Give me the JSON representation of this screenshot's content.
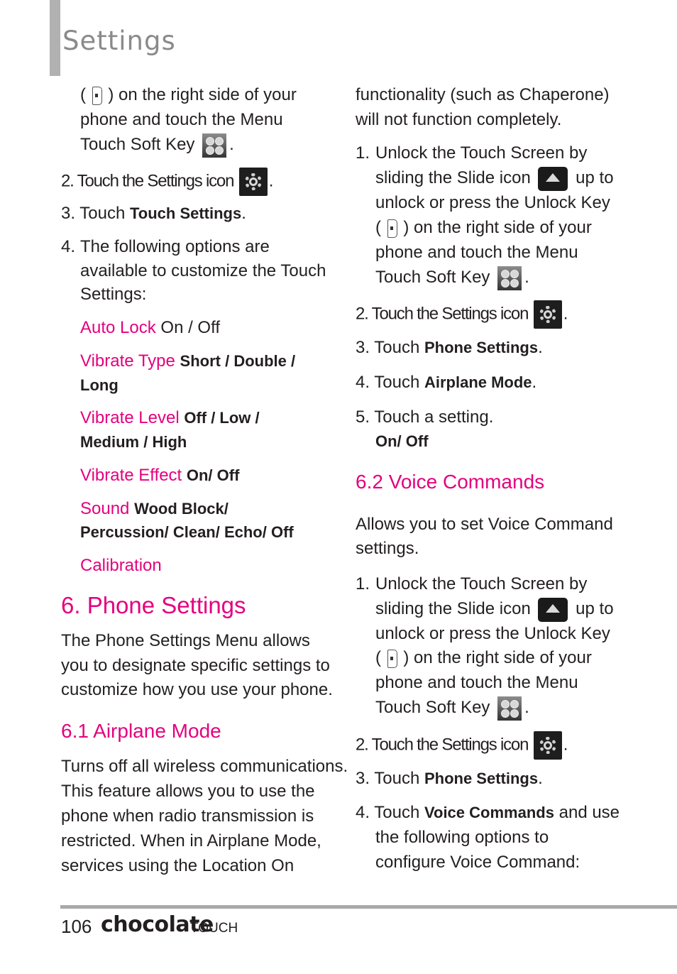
{
  "header": {
    "title": "Settings"
  },
  "left": {
    "intro_line1_after_icon": ") on the right side of your",
    "intro_line1_before_icon": "(",
    "intro_line2": "phone and touch the Menu",
    "intro_line3": "Touch Soft Key",
    "intro_line3_end": ".",
    "step2_num": "2.",
    "step2_text": "Touch the Settings icon",
    "step2_end": ".",
    "step3_num": "3.",
    "step3_text": "Touch",
    "step3_bold": "Touch Settings",
    "step3_end": ".",
    "step4_num": "4.",
    "step4_lines": [
      "The following options are",
      "available to customize the Touch",
      "Settings:"
    ],
    "options": [
      {
        "label": "Auto Lock",
        "values": "On / Off"
      },
      {
        "label": "Vibrate Type",
        "values": "Short / Double /",
        "values2": "Long"
      },
      {
        "label": "Vibrate Level",
        "values": "Off / Low /",
        "values2": "Medium / High"
      },
      {
        "label": "Vibrate Effect",
        "values": "On/ Off"
      },
      {
        "label": "Sound",
        "values": "Wood Block/",
        "values2": "Percussion/ Clean/ Echo/ Off"
      },
      {
        "label": "Calibration"
      }
    ],
    "section_title": "6. Phone Settings",
    "section_body": [
      "The Phone Settings Menu allows",
      "you to designate specific settings to",
      "customize how you use your phone."
    ],
    "sub1_title": "6.1 Airplane Mode",
    "sub1_body": [
      "Turns off all wireless communications.",
      "This feature allows you to use the",
      "phone when radio transmission is",
      "restricted. When in Airplane Mode,",
      "services using the Location On"
    ]
  },
  "right": {
    "cont_lines": [
      "functionality (such as Chaperone)",
      "will not function completely."
    ],
    "a_step1_num": "1.",
    "a_step1_l1": "Unlock the Touch Screen by",
    "a_step1_l2a": "sliding the Slide icon",
    "a_step1_l2b": "up to",
    "a_step1_l3": "unlock or press the Unlock Key",
    "a_step1_l4a": "(",
    "a_step1_l4b": ") on the right side of your",
    "a_step1_l5": "phone and touch the Menu",
    "a_step1_l6": "Touch Soft Key",
    "a_step1_l6_end": ".",
    "a_step2_num": "2.",
    "a_step2_text": "Touch the Settings icon",
    "a_step2_end": ".",
    "a_step3_num": "3.",
    "a_step3_text": "Touch",
    "a_step3_bold": "Phone Settings",
    "a_step3_end": ".",
    "a_step4_num": "4.",
    "a_step4_text": "Touch",
    "a_step4_bold": "Airplane Mode",
    "a_step4_end": ".",
    "a_step5_num": "5.",
    "a_step5_text": "Touch a setting.",
    "a_step5_bold": "On/ Off",
    "sub2_title": "6.2 Voice Commands",
    "sub2_body": [
      "Allows you to set Voice Command",
      "settings."
    ],
    "v_step1_num": "1.",
    "v_step1_l1": "Unlock the Touch Screen by",
    "v_step1_l2a": "sliding the Slide icon",
    "v_step1_l2b": "up to",
    "v_step1_l3": "unlock or press the Unlock Key",
    "v_step1_l4a": "(",
    "v_step1_l4b": ") on the right side of your",
    "v_step1_l5": "phone and touch the Menu",
    "v_step1_l6": "Touch Soft Key",
    "v_step1_l6_end": ".",
    "v_step2_num": "2.",
    "v_step2_text": "Touch the Settings icon",
    "v_step2_end": ".",
    "v_step3_num": "3.",
    "v_step3_text": "Touch",
    "v_step3_bold": "Phone Settings",
    "v_step3_end": ".",
    "v_step4_num": "4.",
    "v_step4_text": "Touch",
    "v_step4_bold": "Voice Commands",
    "v_step4_rest": "and use",
    "v_step4_l2": "the following options to",
    "v_step4_l3": "configure Voice Command:"
  },
  "footer": {
    "page_number": "106",
    "brand": "chocolate",
    "brand_suffix": "TOUCH"
  },
  "colors": {
    "accent": "#e4007f",
    "title_gray": "#8a8a8a",
    "rule_gray": "#a9a9a9"
  }
}
